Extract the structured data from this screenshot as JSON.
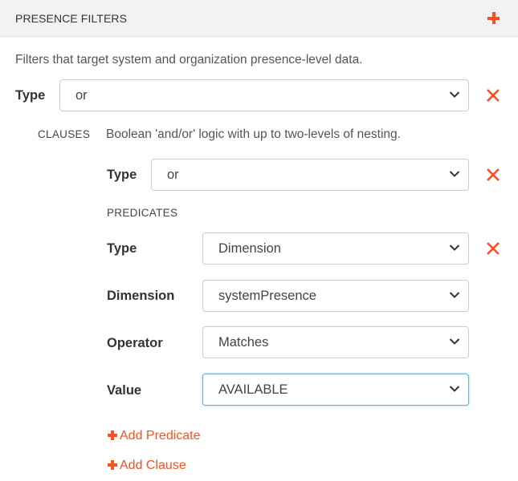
{
  "header": {
    "title": "PRESENCE FILTERS",
    "add_icon": "plus-icon",
    "accent_color": "#ff4f1f"
  },
  "description": "Filters that target system and organization presence-level data.",
  "filter": {
    "type_label": "Type",
    "type_value": "or",
    "remove_icon": "close-icon",
    "clauses": {
      "label": "CLAUSES",
      "description": "Boolean 'and/or' logic with up to two-levels of nesting.",
      "type_label": "Type",
      "type_value": "or",
      "predicates": {
        "label": "PREDICATES",
        "type_label": "Type",
        "type_value": "Dimension",
        "dimension_label": "Dimension",
        "dimension_value": "systemPresence",
        "operator_label": "Operator",
        "operator_value": "Matches",
        "value_label": "Value",
        "value_value": "AVAILABLE"
      },
      "add_predicate": "Add Predicate",
      "add_clause": "Add Clause"
    }
  }
}
